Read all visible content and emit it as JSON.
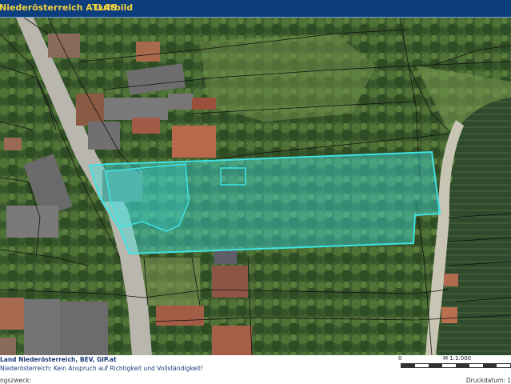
{
  "header": {
    "title": "Niederösterreich ATLAS",
    "layer": "Luftbild"
  },
  "map": {
    "highlight_color": "#3fe3e3",
    "parcel_line_color": "#111111"
  },
  "footer": {
    "source": "Land Niederösterreich, BEV, GIP.at",
    "disclaimer": "Niederösterreich: Kein Anspruch auf Richtigkeit und Vollständigkeit!",
    "purpose_label": "ngszweck:",
    "print_date_label": "Druckdatum: 1",
    "scale": {
      "zero": "0",
      "ratio": "M 1:1.000"
    }
  }
}
